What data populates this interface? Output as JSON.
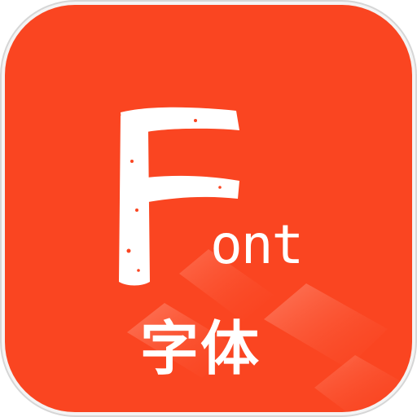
{
  "app_icon": {
    "logo_letter": "F",
    "logo_suffix": "ont",
    "label_cn": "字体",
    "colors": {
      "tile": "#FA4521",
      "text": "#FFFFFF",
      "frame": "#D9D9D9",
      "overlay": "#FF7A5E"
    },
    "icon": "font-app-icon"
  }
}
